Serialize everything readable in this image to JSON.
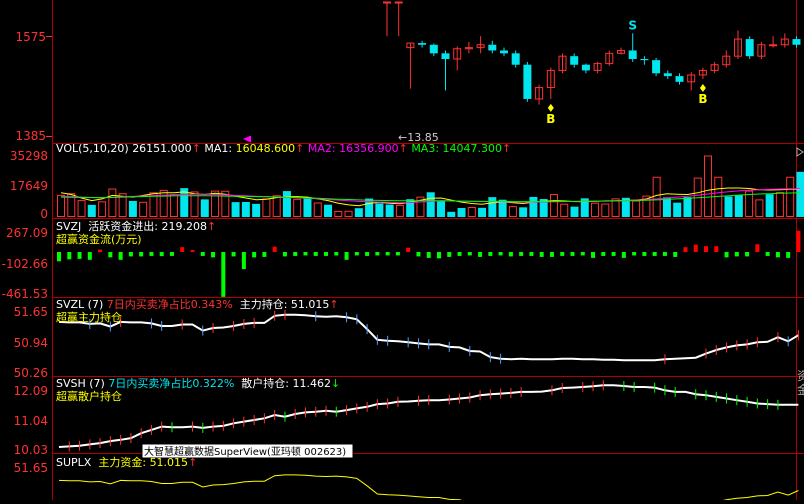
{
  "colors": {
    "up": "#ff3232",
    "down": "#00e5ee",
    "divider": "#b00000",
    "axis_text": "#ff3232",
    "white": "#ffffff",
    "yellow": "#ffff00",
    "magenta": "#ff00ff",
    "green": "#00ff00",
    "pos_bar": "#ff0000",
    "neg_bar": "#00ff00",
    "blue": "#5aa0ff",
    "tooltip_bg": "#ffffff"
  },
  "price_panel": {
    "y_ticks": [
      "1575",
      "1385"
    ],
    "pointer_label": "←13.85",
    "signal_labels": {
      "sell": "S",
      "buy": "B"
    }
  },
  "vol_panel": {
    "y_ticks": [
      "35298",
      "17649",
      "0"
    ],
    "header": {
      "name": "VOL(5,10,20)",
      "value": "26151.000",
      "ma1_label": "MA1:",
      "ma1": "16048.600",
      "ma2_label": "MA2:",
      "ma2": "16356.900",
      "ma3_label": "MA3:",
      "ma3": "14047.300",
      "arrow": "↑"
    }
  },
  "svzj_panel": {
    "y_ticks": [
      "267.09",
      "-102.66",
      "-461.53"
    ],
    "header": {
      "name": "SVZJ",
      "label": "活跃资金进出:",
      "value": "219.208",
      "arrow": "↑",
      "subtitle": "超赢资金流(万元)"
    }
  },
  "svzl_panel": {
    "y_ticks": [
      "51.65",
      "50.94",
      "50.26"
    ],
    "header": {
      "name": "SVZL (7)",
      "ratio_label": "7日内买卖净占比",
      "ratio": "0.343%",
      "hold_label": "主力持仓:",
      "hold": "51.015",
      "arrow": "↑",
      "subtitle": "超赢主力持仓"
    }
  },
  "svsh_panel": {
    "y_ticks": [
      "12.09",
      "11.04",
      "10.03"
    ],
    "header": {
      "name": "SVSH (7)",
      "ratio_label": "7日内买卖净占比",
      "ratio": "0.322%",
      "hold_label": "散户持仓:",
      "hold": "11.462",
      "arrow": "↓",
      "subtitle": "超赢散户持仓"
    },
    "tooltip": "大智慧超赢数据SuperView(亚玛顿 002623)"
  },
  "suplx_panel": {
    "y_ticks": [
      "51.65"
    ],
    "header": {
      "name": "SUPLX",
      "label": "主力资金:",
      "value": "51.015",
      "arrow": "↑"
    }
  },
  "right_edge": {
    "glyph_a": "资",
    "glyph_b": "金"
  },
  "chart_data": [
    {
      "type": "candlestick",
      "title": "",
      "ylim": [
        1385,
        1620
      ],
      "open": [
        1620,
        1620,
        1540,
        1548,
        1545,
        1530,
        1520,
        1538,
        1540,
        1545,
        1535,
        1530,
        1510,
        1450,
        1470,
        1500,
        1525,
        1510,
        1500,
        1512,
        1530,
        1535,
        1520,
        1518,
        1495,
        1490,
        1480,
        1492,
        1500,
        1510,
        1525,
        1555,
        1525,
        1545,
        1545,
        1555
      ],
      "close": [
        1620,
        1620,
        1548,
        1545,
        1530,
        1520,
        1538,
        1540,
        1545,
        1535,
        1530,
        1510,
        1450,
        1470,
        1500,
        1525,
        1510,
        1500,
        1512,
        1530,
        1535,
        1520,
        1518,
        1495,
        1490,
        1480,
        1492,
        1500,
        1510,
        1525,
        1555,
        1525,
        1545,
        1545,
        1555,
        1545
      ],
      "high": [
        1620,
        1620,
        1548,
        1552,
        1547,
        1535,
        1542,
        1550,
        1560,
        1552,
        1540,
        1535,
        1515,
        1475,
        1505,
        1530,
        1530,
        1512,
        1515,
        1535,
        1540,
        1565,
        1525,
        1522,
        1500,
        1495,
        1497,
        1505,
        1515,
        1535,
        1570,
        1560,
        1550,
        1560,
        1565,
        1560
      ],
      "low": [
        1560,
        1560,
        1468,
        1540,
        1525,
        1465,
        1500,
        1530,
        1530,
        1530,
        1525,
        1505,
        1445,
        1440,
        1450,
        1495,
        1505,
        1495,
        1495,
        1508,
        1528,
        1515,
        1510,
        1490,
        1485,
        1475,
        1465,
        1485,
        1495,
        1505,
        1520,
        1520,
        1520,
        1540,
        1540,
        1540
      ],
      "signals": [
        {
          "index": 14,
          "type": "buy"
        },
        {
          "index": 21,
          "type": "sell"
        },
        {
          "index": 27,
          "type": "buy"
        }
      ]
    },
    {
      "type": "bar",
      "title": "VOL(5,10,20)",
      "ylim": [
        0,
        35298
      ],
      "values": [
        12500,
        13500,
        9500,
        7000,
        8800,
        16200,
        13500,
        9300,
        8500,
        14000,
        15400,
        13000,
        16700,
        14500,
        10200,
        15000,
        14900,
        8600,
        8700,
        7600,
        10500,
        12300,
        15000,
        10200,
        10600,
        8100,
        7100,
        3200,
        3300,
        5100,
        10700,
        7900,
        7200,
        6700,
        10300,
        11500,
        14300,
        9300,
        3000,
        5200,
        5500,
        5300,
        11500,
        10000,
        6000,
        5600,
        11600,
        10400,
        13000,
        7400,
        6000,
        10800,
        8000,
        7500,
        10500,
        11100,
        9200,
        12100,
        23000,
        11400,
        8300,
        11500,
        22500,
        35298,
        23000,
        11900,
        12800,
        15000,
        9900,
        13200,
        14200,
        23000,
        26151
      ],
      "up": [
        true,
        true,
        true,
        false,
        true,
        true,
        true,
        false,
        true,
        true,
        true,
        true,
        false,
        true,
        false,
        true,
        true,
        false,
        false,
        false,
        true,
        true,
        false,
        true,
        false,
        true,
        false,
        true,
        true,
        false,
        false,
        false,
        false,
        true,
        false,
        true,
        false,
        false,
        false,
        false,
        true,
        false,
        false,
        false,
        true,
        false,
        false,
        false,
        true,
        true,
        false,
        false,
        true,
        true,
        true,
        false,
        true,
        true,
        true,
        false,
        false,
        false,
        true,
        true,
        true,
        false,
        false,
        true,
        true,
        false,
        true,
        true,
        false
      ],
      "series": [
        {
          "name": "MA1",
          "values": [
            14000,
            13000,
            11000,
            9500,
            10500,
            12500,
            12000,
            11500,
            12500,
            13500,
            14000,
            14000,
            14500,
            13500,
            13000,
            13800,
            13200,
            12000,
            11000,
            10000,
            10300,
            11200,
            11700,
            11800,
            11500,
            10500,
            9500,
            8000,
            7000,
            6500,
            7800,
            8500,
            7900,
            7700,
            8500,
            9700,
            10800,
            11000,
            9800,
            8600,
            7800,
            7400,
            8300,
            8700,
            8300,
            7800,
            8500,
            9000,
            9500,
            9300,
            8900,
            8900,
            9100,
            9300,
            9400,
            9600,
            9800,
            10400,
            12500,
            13500,
            13200,
            13000,
            14000,
            15500,
            16400,
            16800,
            16800,
            16500,
            15800,
            15600,
            15800,
            16000,
            16049
          ]
        },
        {
          "name": "MA2",
          "values": [
            12000,
            11900,
            11600,
            11300,
            11100,
            11400,
            11800,
            11900,
            12100,
            12400,
            12700,
            12900,
            13100,
            13200,
            13200,
            13000,
            12800,
            12500,
            12300,
            12000,
            11800,
            11500,
            11300,
            11100,
            10900,
            10600,
            10200,
            9800,
            9400,
            9000,
            8800,
            8700,
            8500,
            8300,
            8400,
            8700,
            9000,
            9300,
            9300,
            9200,
            9100,
            9000,
            8900,
            8800,
            8700,
            8600,
            8600,
            8700,
            8800,
            8900,
            9000,
            9100,
            9200,
            9300,
            9400,
            9500,
            9700,
            10000,
            10500,
            11000,
            11500,
            12000,
            12600,
            13300,
            14000,
            14600,
            15100,
            15500,
            15800,
            16000,
            16200,
            16300,
            16357
          ]
        },
        {
          "name": "MA3",
          "values": [
            11500,
            11400,
            11300,
            11200,
            11200,
            11300,
            11500,
            11700,
            11800,
            12000,
            12100,
            12200,
            12300,
            12300,
            12300,
            12200,
            12100,
            12000,
            11900,
            11800,
            11700,
            11600,
            11400,
            11200,
            11000,
            10800,
            10600,
            10300,
            10100,
            9900,
            9700,
            9600,
            9500,
            9400,
            9400,
            9400,
            9400,
            9400,
            9300,
            9200,
            9100,
            9000,
            9000,
            9000,
            8900,
            8900,
            8900,
            8900,
            8900,
            9000,
            9000,
            9100,
            9100,
            9200,
            9300,
            9400,
            9500,
            9700,
            9900,
            10200,
            10500,
            10800,
            11100,
            11500,
            11900,
            12300,
            12700,
            13000,
            13300,
            13500,
            13700,
            13900,
            14047
          ]
        }
      ]
    },
    {
      "type": "bar",
      "title": "SVZJ",
      "ylim": [
        -461.53,
        267.09
      ],
      "values": [
        -95,
        -75,
        -70,
        -80,
        25,
        -55,
        -80,
        -45,
        -45,
        -40,
        -42,
        -40,
        50,
        20,
        -40,
        -55,
        -460,
        -45,
        -175,
        -55,
        -50,
        55,
        -45,
        -40,
        -35,
        -40,
        -40,
        -35,
        -80,
        -35,
        -40,
        -35,
        -35,
        -35,
        45,
        -45,
        -60,
        -65,
        -50,
        -40,
        -35,
        -50,
        -40,
        -35,
        -45,
        -40,
        -40,
        -50,
        -50,
        -40,
        -40,
        -35,
        -60,
        -40,
        -40,
        -60,
        -35,
        -40,
        -40,
        -40,
        -50,
        50,
        75,
        60,
        60,
        -55,
        -45,
        -45,
        80,
        -40,
        -55,
        -60,
        219
      ]
    },
    {
      "type": "line",
      "title": "SVZL",
      "ylim": [
        50.26,
        51.65
      ],
      "values": [
        51.28,
        51.27,
        51.27,
        51.24,
        51.25,
        51.19,
        51.28,
        51.27,
        51.27,
        51.25,
        51.2,
        51.2,
        51.23,
        51.23,
        51.11,
        51.16,
        51.17,
        51.2,
        51.24,
        51.26,
        51.26,
        51.4,
        51.42,
        51.42,
        51.41,
        51.39,
        51.38,
        51.39,
        51.37,
        51.33,
        51.14,
        50.93,
        50.91,
        50.9,
        50.88,
        50.86,
        50.84,
        50.84,
        50.79,
        50.78,
        50.71,
        50.7,
        50.59,
        50.56,
        50.55,
        50.56,
        50.55,
        50.55,
        50.55,
        50.56,
        50.56,
        50.55,
        50.55,
        50.54,
        50.54,
        50.53,
        50.53,
        50.53,
        50.53,
        50.55,
        50.56,
        50.57,
        50.58,
        50.66,
        50.73,
        50.78,
        50.82,
        50.84,
        50.88,
        50.89,
        50.98,
        50.9,
        51.02
      ]
    },
    {
      "type": "line",
      "title": "SVSH",
      "ylim": [
        10.03,
        12.09
      ],
      "values": [
        10.18,
        10.2,
        10.22,
        10.26,
        10.3,
        10.36,
        10.4,
        10.45,
        10.6,
        10.7,
        10.8,
        10.78,
        10.78,
        10.8,
        10.76,
        10.8,
        10.82,
        10.9,
        10.95,
        11.0,
        11.05,
        11.15,
        11.1,
        11.18,
        11.23,
        11.25,
        11.28,
        11.25,
        11.3,
        11.35,
        11.4,
        11.48,
        11.5,
        11.55,
        11.56,
        11.58,
        11.6,
        11.6,
        11.62,
        11.65,
        11.68,
        11.75,
        11.78,
        11.8,
        11.82,
        11.85,
        11.85,
        11.86,
        11.9,
        11.97,
        11.98,
        12.0,
        12.02,
        12.05,
        12.05,
        12.03,
        12.0,
        12.0,
        11.98,
        11.9,
        11.85,
        11.85,
        11.78,
        11.75,
        11.7,
        11.65,
        11.6,
        11.55,
        11.5,
        11.48,
        11.46,
        11.46,
        11.46
      ]
    }
  ]
}
